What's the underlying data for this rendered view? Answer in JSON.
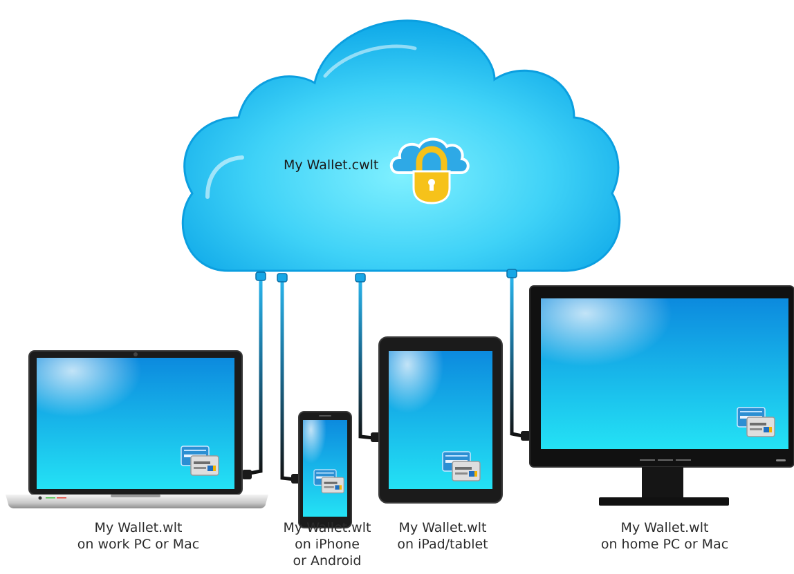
{
  "cloud": {
    "file_name": "My Wallet.cwlt",
    "icon": "cloud-padlock-icon"
  },
  "devices": [
    {
      "id": "laptop",
      "icon": "laptop-icon",
      "lines": [
        "My Wallet.wlt",
        "on work PC or Mac"
      ]
    },
    {
      "id": "phone",
      "icon": "smartphone-icon",
      "lines": [
        "My Wallet.wlt",
        "on iPhone",
        "or Android"
      ]
    },
    {
      "id": "tablet",
      "icon": "tablet-icon",
      "lines": [
        "My Wallet.wlt",
        "on iPad/tablet"
      ]
    },
    {
      "id": "monitor",
      "icon": "desktop-monitor-icon",
      "lines": [
        "My Wallet.wlt",
        "on home PC or Mac"
      ]
    }
  ],
  "colors": {
    "cloud_light": "#7ff0ff",
    "cloud_mid": "#27c4f3",
    "cloud_dark": "#0aa5e6",
    "lock_gold": "#f6c21a",
    "device_frame": "#1b1b1b",
    "screen_top": "#0e8fe0",
    "screen_bottom": "#22e0f4",
    "cable": "#111111"
  }
}
